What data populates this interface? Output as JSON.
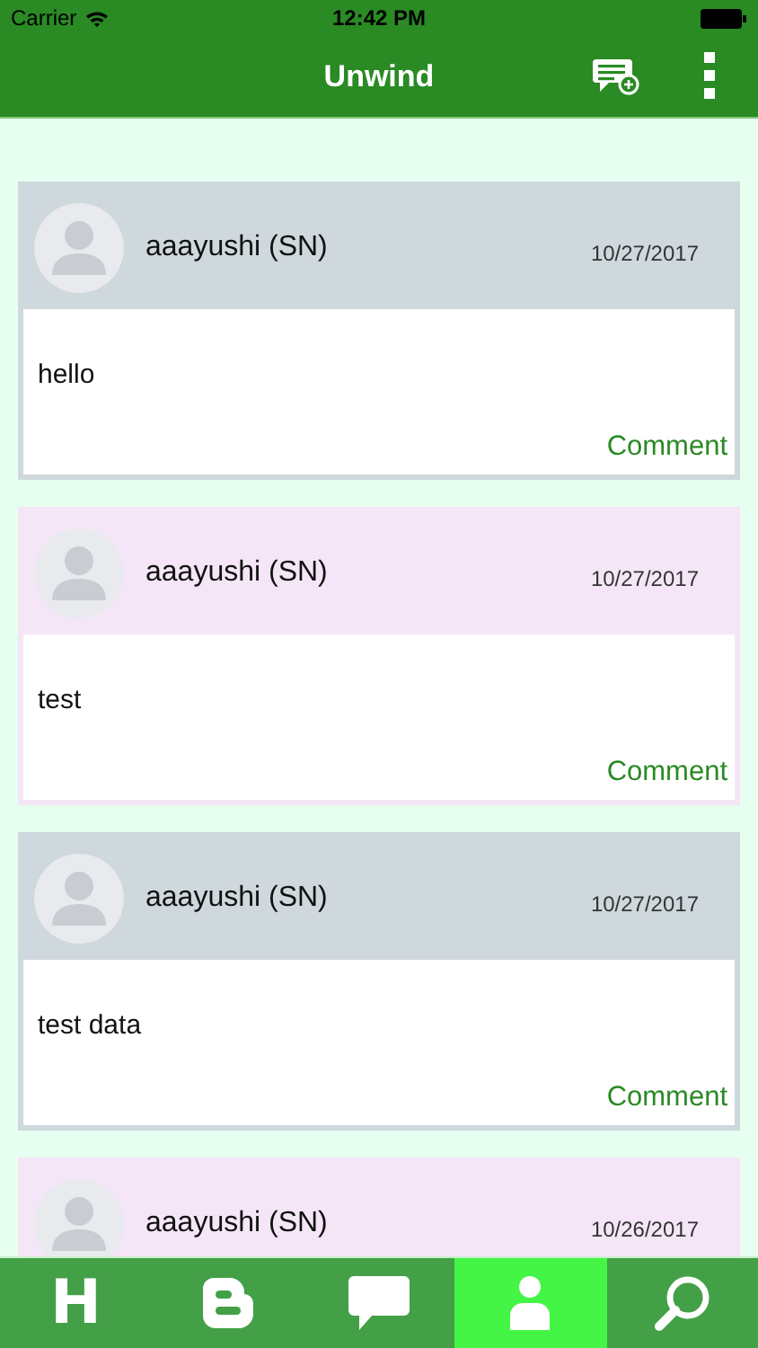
{
  "status_bar": {
    "carrier": "Carrier",
    "time": "12:42 PM"
  },
  "nav_bar": {
    "title": "Unwind"
  },
  "posts": [
    {
      "author": "aaayushi (SN)",
      "date": "10/27/2017",
      "text": "hello",
      "action": "Comment",
      "color": "#cfd8dc"
    },
    {
      "author": "aaayushi (SN)",
      "date": "10/27/2017",
      "text": "test",
      "action": "Comment",
      "color": "#f5e6f7"
    },
    {
      "author": "aaayushi (SN)",
      "date": "10/27/2017",
      "text": "test data",
      "action": "Comment",
      "color": "#cfd8dc"
    },
    {
      "author": "aaayushi (SN)",
      "date": "10/26/2017",
      "color": "#f5e6f7"
    }
  ],
  "tab_bar": [
    {
      "kind": "letter",
      "label": "H",
      "selected": false
    },
    {
      "kind": "blog",
      "selected": false
    },
    {
      "kind": "chat",
      "selected": false
    },
    {
      "kind": "profile",
      "selected": true
    },
    {
      "kind": "search",
      "selected": false
    }
  ]
}
